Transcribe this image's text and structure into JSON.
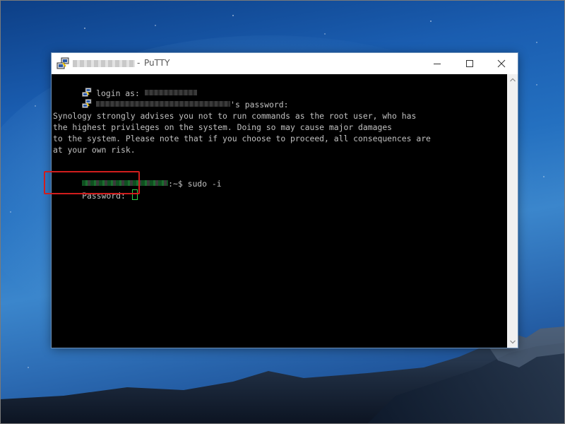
{
  "window": {
    "title_app": "PuTTY",
    "title_separator": "-",
    "buttons": {
      "minimize_icon": "minimize-icon",
      "maximize_icon": "maximize-icon",
      "close_icon": "close-icon"
    }
  },
  "console": {
    "login_prompt": "login as: ",
    "password_prompt_suffix": "'s password:",
    "warning_lines": [
      "Synology strongly advises you not to run commands as the root user, who has",
      "the highest privileges on the system. Doing so may cause major damages",
      "to the system. Please note that if you choose to proceed, all consequences are",
      "at your own risk."
    ],
    "shell_prompt_suffix": ":~$ ",
    "command": "sudo -i",
    "sudo_password_prompt": "Password: "
  },
  "colors": {
    "console_bg": "#000000",
    "console_fg": "#c0c0c0",
    "cursor": "#2bd44a",
    "highlight": "#d11d1d"
  }
}
